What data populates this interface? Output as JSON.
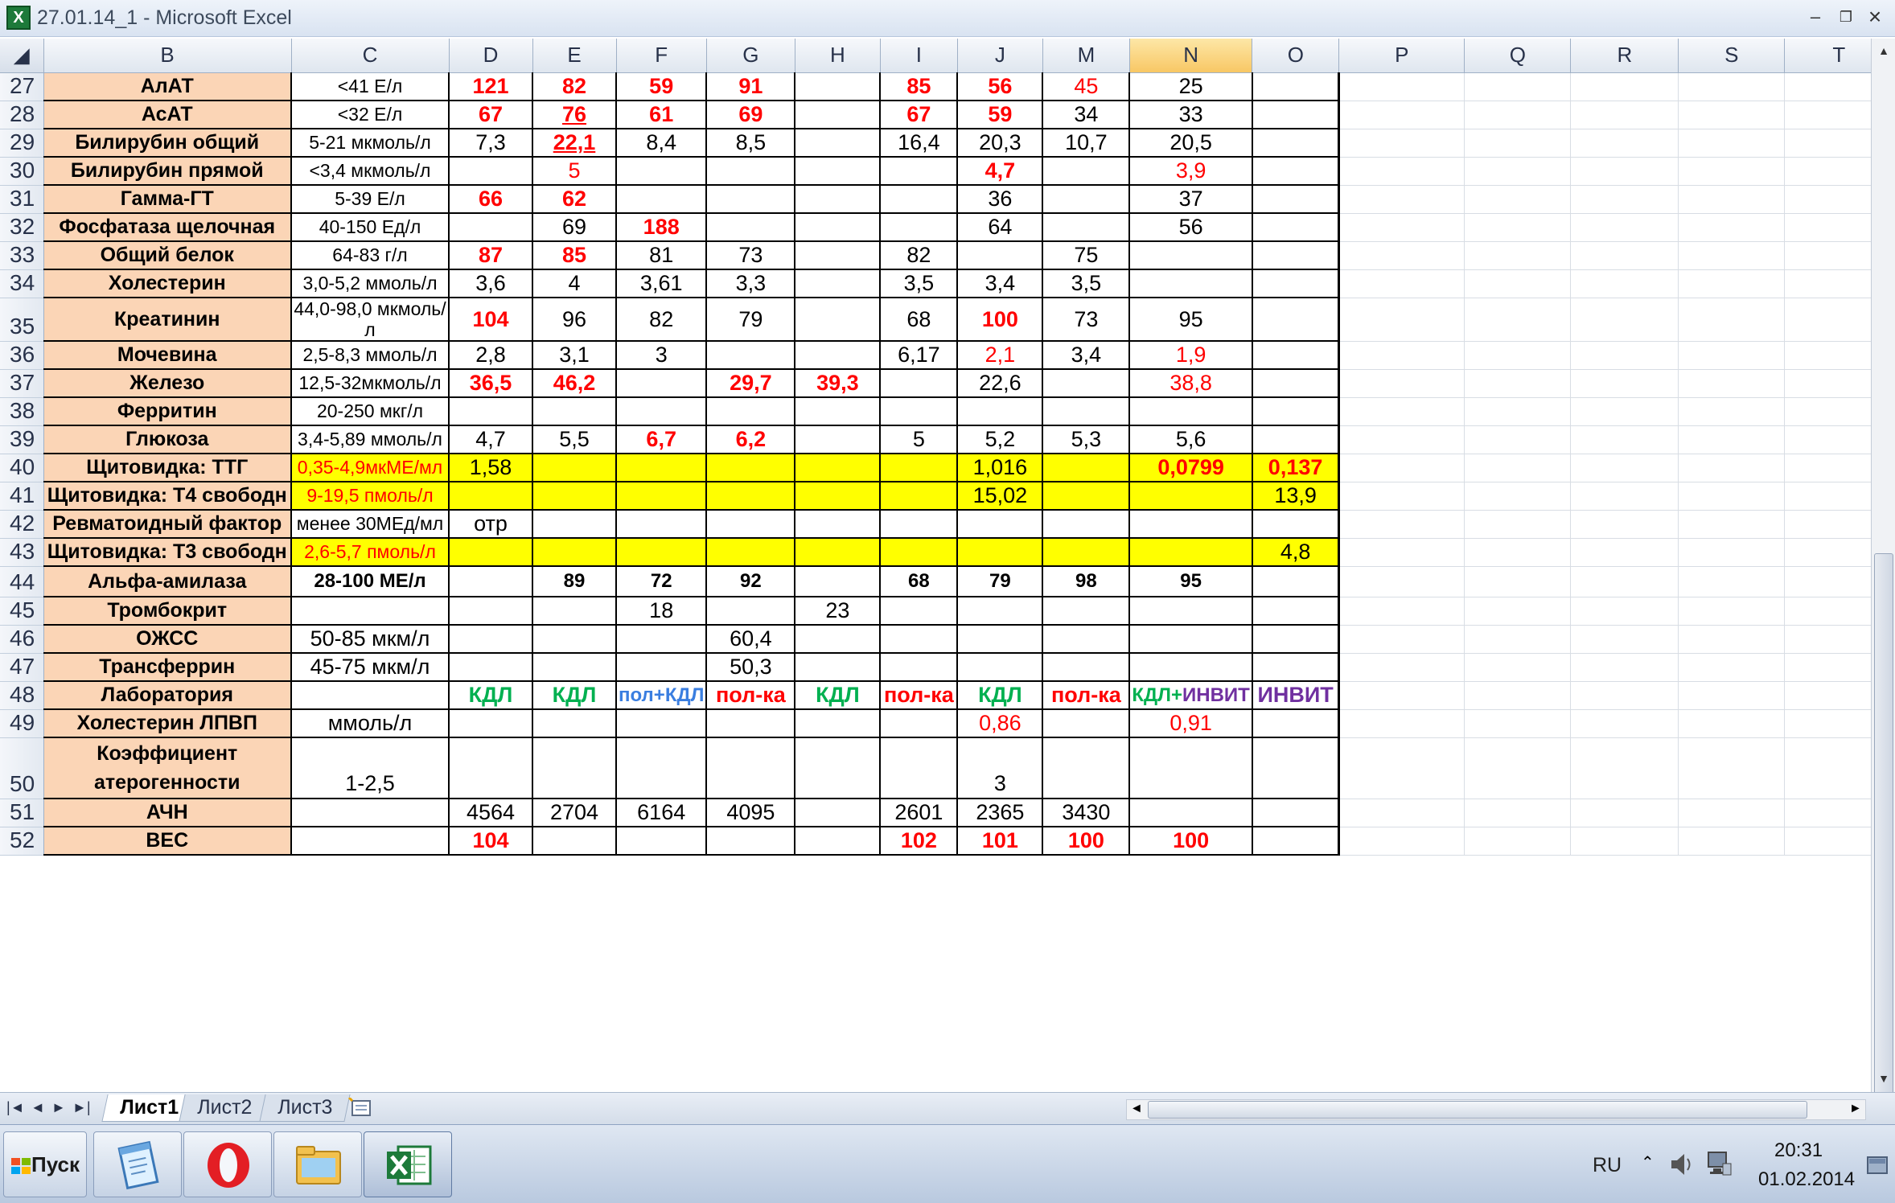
{
  "window": {
    "title": "27.01.14_1 - Microsoft Excel",
    "app_icon": "X",
    "minimize": "–",
    "restore": "❐",
    "close": "×"
  },
  "columns": [
    "B",
    "C",
    "D",
    "E",
    "F",
    "G",
    "H",
    "I",
    "J",
    "M",
    "N",
    "O",
    "P",
    "Q",
    "R",
    "S",
    "T"
  ],
  "selected_column": "N",
  "rows": [
    {
      "num": "27",
      "label": "АлАТ",
      "ref": "<41 Е/л",
      "values": [
        {
          "v": "121",
          "s": "r b"
        },
        {
          "v": "82",
          "s": "r b"
        },
        {
          "v": "59",
          "s": "r b"
        },
        {
          "v": "91",
          "s": "r b"
        },
        {
          "v": ""
        },
        {
          "v": "85",
          "s": "r b"
        },
        {
          "v": "56",
          "s": "r b"
        },
        {
          "v": "45",
          "s": "r"
        },
        {
          "v": "25"
        },
        {
          "v": ""
        }
      ]
    },
    {
      "num": "28",
      "label": "АсАТ",
      "ref": "<32 Е/л",
      "values": [
        {
          "v": "67",
          "s": "r b"
        },
        {
          "v": "76",
          "s": "r b u"
        },
        {
          "v": "61",
          "s": "r b"
        },
        {
          "v": "69",
          "s": "r b"
        },
        {
          "v": ""
        },
        {
          "v": "67",
          "s": "r b"
        },
        {
          "v": "59",
          "s": "r b"
        },
        {
          "v": "34"
        },
        {
          "v": "33"
        },
        {
          "v": ""
        }
      ]
    },
    {
      "num": "29",
      "label": "Билирубин общий",
      "ref": "5-21 мкмоль/л",
      "values": [
        {
          "v": "7,3"
        },
        {
          "v": "22,1",
          "s": "r b u"
        },
        {
          "v": "8,4"
        },
        {
          "v": "8,5"
        },
        {
          "v": ""
        },
        {
          "v": "16,4"
        },
        {
          "v": "20,3"
        },
        {
          "v": "10,7"
        },
        {
          "v": "20,5"
        },
        {
          "v": ""
        }
      ]
    },
    {
      "num": "30",
      "label": "Билирубин прямой",
      "ref": "<3,4 мкмоль/л",
      "values": [
        {
          "v": ""
        },
        {
          "v": "5",
          "s": "r"
        },
        {
          "v": ""
        },
        {
          "v": ""
        },
        {
          "v": ""
        },
        {
          "v": ""
        },
        {
          "v": "4,7",
          "s": "r b"
        },
        {
          "v": ""
        },
        {
          "v": "3,9",
          "s": "r"
        },
        {
          "v": ""
        }
      ]
    },
    {
      "num": "31",
      "label": "Гамма-ГТ",
      "ref": "5-39 Е/л",
      "values": [
        {
          "v": "66",
          "s": "r b"
        },
        {
          "v": "62",
          "s": "r b"
        },
        {
          "v": ""
        },
        {
          "v": ""
        },
        {
          "v": ""
        },
        {
          "v": ""
        },
        {
          "v": "36"
        },
        {
          "v": ""
        },
        {
          "v": "37"
        },
        {
          "v": ""
        }
      ]
    },
    {
      "num": "32",
      "label": "Фосфатаза щелочная",
      "ref": "40-150 Ед/л",
      "values": [
        {
          "v": ""
        },
        {
          "v": "69"
        },
        {
          "v": "188",
          "s": "r b"
        },
        {
          "v": ""
        },
        {
          "v": ""
        },
        {
          "v": ""
        },
        {
          "v": "64"
        },
        {
          "v": ""
        },
        {
          "v": "56"
        },
        {
          "v": ""
        }
      ]
    },
    {
      "num": "33",
      "label": "Общий белок",
      "ref": "64-83 г/л",
      "values": [
        {
          "v": "87",
          "s": "r b"
        },
        {
          "v": "85",
          "s": "r b"
        },
        {
          "v": "81"
        },
        {
          "v": "73"
        },
        {
          "v": ""
        },
        {
          "v": "82"
        },
        {
          "v": ""
        },
        {
          "v": "75"
        },
        {
          "v": ""
        },
        {
          "v": ""
        }
      ]
    },
    {
      "num": "34",
      "label": "Холестерин",
      "ref": "3,0-5,2 ммоль/л",
      "values": [
        {
          "v": "3,6"
        },
        {
          "v": "4"
        },
        {
          "v": "3,61"
        },
        {
          "v": "3,3"
        },
        {
          "v": ""
        },
        {
          "v": "3,5"
        },
        {
          "v": "3,4"
        },
        {
          "v": "3,5"
        },
        {
          "v": ""
        },
        {
          "v": ""
        }
      ]
    },
    {
      "num": "35",
      "label": "Креатинин",
      "ref": "44,0-98,0 мкмоль/л",
      "values": [
        {
          "v": "104",
          "s": "r b"
        },
        {
          "v": "96"
        },
        {
          "v": "82"
        },
        {
          "v": "79"
        },
        {
          "v": ""
        },
        {
          "v": "68"
        },
        {
          "v": "100",
          "s": "r b"
        },
        {
          "v": "73"
        },
        {
          "v": "95"
        },
        {
          "v": ""
        }
      ]
    },
    {
      "num": "36",
      "label": "Мочевина",
      "ref": "2,5-8,3 ммоль/л",
      "values": [
        {
          "v": "2,8"
        },
        {
          "v": "3,1"
        },
        {
          "v": "3"
        },
        {
          "v": ""
        },
        {
          "v": ""
        },
        {
          "v": "6,17"
        },
        {
          "v": "2,1",
          "s": "r"
        },
        {
          "v": "3,4"
        },
        {
          "v": "1,9",
          "s": "r"
        },
        {
          "v": ""
        }
      ]
    },
    {
      "num": "37",
      "label": "Железо",
      "ref": "12,5-32мкмоль/л",
      "values": [
        {
          "v": "36,5",
          "s": "r b"
        },
        {
          "v": "46,2",
          "s": "r b"
        },
        {
          "v": ""
        },
        {
          "v": "29,7",
          "s": "r b"
        },
        {
          "v": "39,3",
          "s": "r b"
        },
        {
          "v": ""
        },
        {
          "v": "22,6"
        },
        {
          "v": ""
        },
        {
          "v": "38,8",
          "s": "r"
        },
        {
          "v": ""
        }
      ]
    },
    {
      "num": "38",
      "label": "Ферритин",
      "ref": "20-250 мкг/л",
      "values": [
        {
          "v": ""
        },
        {
          "v": ""
        },
        {
          "v": ""
        },
        {
          "v": ""
        },
        {
          "v": ""
        },
        {
          "v": ""
        },
        {
          "v": ""
        },
        {
          "v": ""
        },
        {
          "v": ""
        },
        {
          "v": ""
        }
      ]
    },
    {
      "num": "39",
      "label": "Глюкоза",
      "ref": "3,4-5,89 ммоль/л",
      "values": [
        {
          "v": "4,7"
        },
        {
          "v": "5,5"
        },
        {
          "v": "6,7",
          "s": "r b"
        },
        {
          "v": "6,2",
          "s": "r b"
        },
        {
          "v": ""
        },
        {
          "v": "5"
        },
        {
          "v": "5,2"
        },
        {
          "v": "5,3"
        },
        {
          "v": "5,6"
        },
        {
          "v": ""
        }
      ]
    },
    {
      "num": "40",
      "label": "Щитовидка: ТТГ",
      "ref": "0,35-4,9мкМЕ/мл",
      "yellow": true,
      "values": [
        {
          "v": "1,58"
        },
        {
          "v": ""
        },
        {
          "v": ""
        },
        {
          "v": ""
        },
        {
          "v": ""
        },
        {
          "v": ""
        },
        {
          "v": "1,016"
        },
        {
          "v": ""
        },
        {
          "v": "0,0799",
          "s": "r b"
        },
        {
          "v": "0,137",
          "s": "r b"
        }
      ]
    },
    {
      "num": "41",
      "label": "Щитовидка: Т4 свободн",
      "ref": "9-19,5 пмоль/л",
      "yellow": true,
      "values": [
        {
          "v": ""
        },
        {
          "v": ""
        },
        {
          "v": ""
        },
        {
          "v": ""
        },
        {
          "v": ""
        },
        {
          "v": ""
        },
        {
          "v": "15,02"
        },
        {
          "v": ""
        },
        {
          "v": ""
        },
        {
          "v": "13,9"
        }
      ]
    },
    {
      "num": "42",
      "label": "Ревматоидный фактор",
      "ref": "менее 30МЕд/мл",
      "values": [
        {
          "v": "отр"
        },
        {
          "v": ""
        },
        {
          "v": ""
        },
        {
          "v": ""
        },
        {
          "v": ""
        },
        {
          "v": ""
        },
        {
          "v": ""
        },
        {
          "v": ""
        },
        {
          "v": ""
        },
        {
          "v": ""
        }
      ]
    },
    {
      "num": "43",
      "label": "Щитовидка: Т3 свободн",
      "ref": "2,6-5,7 пмоль/л",
      "yellow": true,
      "values": [
        {
          "v": ""
        },
        {
          "v": ""
        },
        {
          "v": ""
        },
        {
          "v": ""
        },
        {
          "v": ""
        },
        {
          "v": ""
        },
        {
          "v": ""
        },
        {
          "v": ""
        },
        {
          "v": ""
        },
        {
          "v": "4,8"
        }
      ]
    },
    {
      "num": "44",
      "label": "Альфа-амилаза",
      "ref": "28-100 МЕ/л",
      "refstyle": "bold",
      "values": [
        {
          "v": ""
        },
        {
          "v": "89",
          "s": "b sm"
        },
        {
          "v": "72",
          "s": "b sm"
        },
        {
          "v": "92",
          "s": "b sm"
        },
        {
          "v": ""
        },
        {
          "v": "68",
          "s": "b sm"
        },
        {
          "v": "79",
          "s": "b sm"
        },
        {
          "v": "98",
          "s": "b sm"
        },
        {
          "v": "95",
          "s": "b sm"
        },
        {
          "v": ""
        }
      ]
    },
    {
      "num": "45",
      "label": "Тромбокрит",
      "ref": "",
      "values": [
        {
          "v": ""
        },
        {
          "v": ""
        },
        {
          "v": "18"
        },
        {
          "v": ""
        },
        {
          "v": "23"
        },
        {
          "v": ""
        },
        {
          "v": ""
        },
        {
          "v": ""
        },
        {
          "v": ""
        },
        {
          "v": ""
        }
      ]
    },
    {
      "num": "46",
      "label": "ОЖСС",
      "ref": "50-85 мкм/л",
      "refstyle": "big",
      "values": [
        {
          "v": ""
        },
        {
          "v": ""
        },
        {
          "v": ""
        },
        {
          "v": "60,4"
        },
        {
          "v": ""
        },
        {
          "v": ""
        },
        {
          "v": ""
        },
        {
          "v": ""
        },
        {
          "v": ""
        },
        {
          "v": ""
        }
      ]
    },
    {
      "num": "47",
      "label": "Трансферрин",
      "ref": "45-75 мкм/л",
      "refstyle": "big",
      "values": [
        {
          "v": ""
        },
        {
          "v": ""
        },
        {
          "v": ""
        },
        {
          "v": "50,3"
        },
        {
          "v": ""
        },
        {
          "v": ""
        },
        {
          "v": ""
        },
        {
          "v": ""
        },
        {
          "v": ""
        },
        {
          "v": ""
        }
      ]
    },
    {
      "num": "48",
      "label": "Лаборатория",
      "ref": "",
      "values": [
        {
          "v": "КДЛ",
          "s": "green"
        },
        {
          "v": "КДЛ",
          "s": "green"
        },
        {
          "v": "пол+КДЛ",
          "s": "blue"
        },
        {
          "v": "пол-ка",
          "s": "r b"
        },
        {
          "v": "КДЛ",
          "s": "green"
        },
        {
          "v": "пол-ка",
          "s": "r b"
        },
        {
          "v": "КДЛ",
          "s": "green"
        },
        {
          "v": "пол-ка",
          "s": "r b"
        },
        {
          "v": "КДЛ+ИНВИТ",
          "s": "mixed"
        },
        {
          "v": "ИНВИТ",
          "s": "purple"
        }
      ]
    },
    {
      "num": "49",
      "label": "Холестерин ЛПВП",
      "ref": "ммоль/л",
      "refstyle": "big",
      "values": [
        {
          "v": ""
        },
        {
          "v": ""
        },
        {
          "v": ""
        },
        {
          "v": ""
        },
        {
          "v": ""
        },
        {
          "v": ""
        },
        {
          "v": "0,86",
          "s": "r"
        },
        {
          "v": ""
        },
        {
          "v": "0,91",
          "s": "r"
        },
        {
          "v": ""
        }
      ]
    },
    {
      "num": "50",
      "label": "Коэффициент атерогенности",
      "ref": "1-2,5",
      "refstyle": "big",
      "tall": true,
      "values": [
        {
          "v": ""
        },
        {
          "v": ""
        },
        {
          "v": ""
        },
        {
          "v": ""
        },
        {
          "v": ""
        },
        {
          "v": ""
        },
        {
          "v": "3"
        },
        {
          "v": ""
        },
        {
          "v": ""
        },
        {
          "v": ""
        }
      ]
    },
    {
      "num": "51",
      "label": "АЧН",
      "ref": "",
      "values": [
        {
          "v": "4564"
        },
        {
          "v": "2704"
        },
        {
          "v": "6164"
        },
        {
          "v": "4095"
        },
        {
          "v": ""
        },
        {
          "v": "2601"
        },
        {
          "v": "2365"
        },
        {
          "v": "3430"
        },
        {
          "v": ""
        },
        {
          "v": ""
        }
      ]
    },
    {
      "num": "52",
      "label": "ВЕС",
      "ref": "",
      "values": [
        {
          "v": "104",
          "s": "r b"
        },
        {
          "v": ""
        },
        {
          "v": ""
        },
        {
          "v": ""
        },
        {
          "v": ""
        },
        {
          "v": "102",
          "s": "r b"
        },
        {
          "v": "101",
          "s": "r b"
        },
        {
          "v": "100",
          "s": "r b"
        },
        {
          "v": "100",
          "s": "r b"
        },
        {
          "v": ""
        }
      ]
    }
  ],
  "sheet_tabs": [
    {
      "label": "Лист1",
      "active": true
    },
    {
      "label": "Лист2"
    },
    {
      "label": "Лист3"
    }
  ],
  "sheet_nav": [
    "|◄",
    "◄",
    "►",
    "►|"
  ],
  "taskbar": {
    "start_label": "Пуск",
    "language": "RU",
    "time": "20:31",
    "date": "01.02.2014"
  },
  "colors": {
    "label_fill": "#fbd5b6",
    "highlight_fill": "#ffff00",
    "red": "#ff0000",
    "green": "#00b050",
    "blue": "#3a7ee0",
    "purple": "#7030a0"
  },
  "icons": [
    "excel-icon",
    "notepad-icon",
    "opera-icon",
    "folder-icon",
    "excel-taskbar-icon",
    "speaker-icon",
    "network-icon",
    "show-desktop-icon",
    "windows-flag-icon"
  ]
}
